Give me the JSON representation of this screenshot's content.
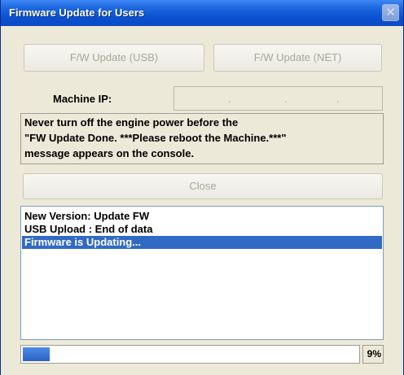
{
  "window": {
    "title": "Firmware Update for Users",
    "close_glyph": "✕"
  },
  "buttons": {
    "usb_label": "F/W Update (USB)",
    "net_label": "F/W Update (NET)",
    "close_label": "Close"
  },
  "machine_ip": {
    "label": "Machine IP:",
    "octet_separators": [
      ".",
      ".",
      "."
    ]
  },
  "warning": {
    "lines": [
      "Never turn off the engine power before the",
      "\"FW Update Done. ***Please reboot the Machine.***\"",
      "message appears on the console."
    ]
  },
  "log": {
    "items": [
      {
        "text": "New Version: Update FW",
        "selected": false
      },
      {
        "text": "USB Upload : End of data",
        "selected": false
      },
      {
        "text": "Firmware is Updating...",
        "selected": true
      }
    ]
  },
  "progress": {
    "percent_text": "9%",
    "fraction": 0.09
  },
  "colors": {
    "selection": "#316ac5",
    "progress_fill": "#2a62c7"
  }
}
